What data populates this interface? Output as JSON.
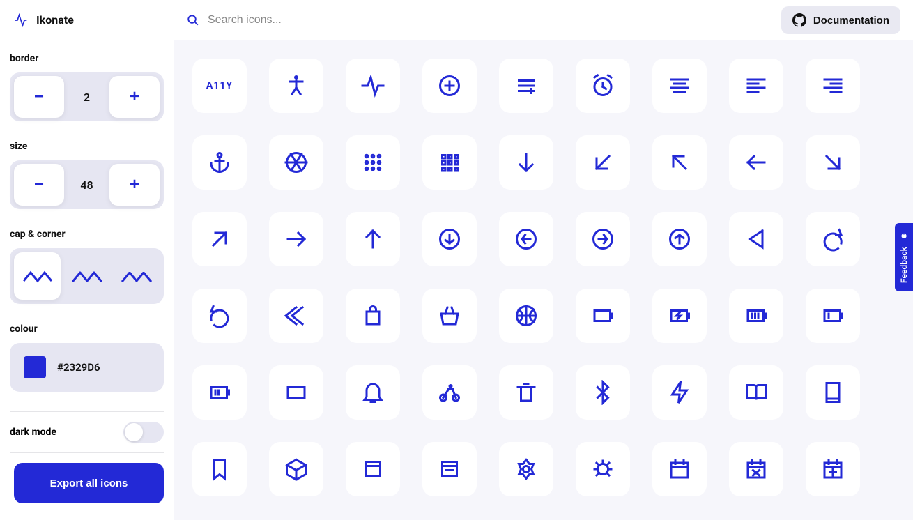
{
  "app": {
    "name": "Ikonate"
  },
  "search": {
    "placeholder": "Search icons..."
  },
  "header": {
    "doc_label": "Documentation"
  },
  "sidebar": {
    "border_label": "border",
    "border_value": "2",
    "size_label": "size",
    "size_value": "48",
    "cap_label": "cap & corner",
    "colour_label": "colour",
    "colour_value": "#2329D6",
    "dark_label": "dark mode",
    "export_label": "Export all icons"
  },
  "feedback": {
    "label": "Feedback"
  },
  "icons": [
    "a11y",
    "accessibility-human",
    "activity",
    "add-circle",
    "add-to-list",
    "alarm",
    "align-center",
    "align-left",
    "align-right",
    "anchor",
    "aperture",
    "apps",
    "apps-alt",
    "arrow-down",
    "arrow-down-left",
    "arrow-up-left",
    "arrow-left",
    "arrow-down-right",
    "arrow-up-right",
    "arrow-right",
    "arrow-up",
    "arrow-down-circle",
    "arrow-left-circle",
    "arrow-right-circle",
    "arrow-up-circle",
    "back",
    "undo",
    "redo",
    "previous",
    "bag",
    "basket",
    "basketball",
    "battery",
    "battery-charging",
    "battery-full",
    "battery-low",
    "battery-medium",
    "battery-alt",
    "bell",
    "bike",
    "bin",
    "bluetooth",
    "bolt",
    "book-open",
    "book",
    "bookmark",
    "box",
    "box-alt",
    "box-alt2",
    "brightness",
    "bug",
    "calendar",
    "calendar-x",
    "calendar-add"
  ],
  "accent": "#2329D6"
}
